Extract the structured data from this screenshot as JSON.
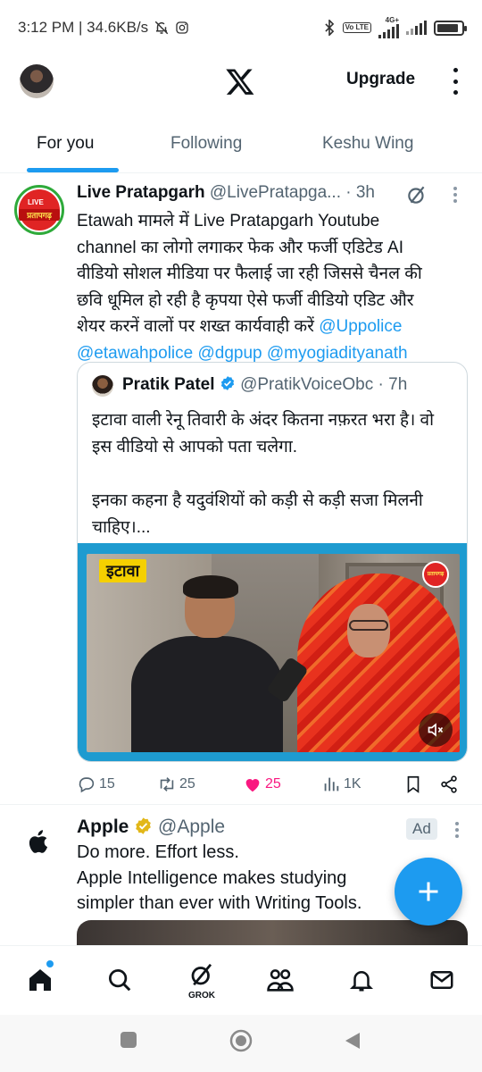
{
  "status_bar": {
    "time_speed": "3:12 PM | 34.6KB/s",
    "network_label": "4G+",
    "volte_label": "Vo LTE"
  },
  "header": {
    "upgrade_label": "Upgrade"
  },
  "tabs": [
    {
      "label": "For you",
      "active": true
    },
    {
      "label": "Following",
      "active": false
    },
    {
      "label": "Keshu Wing",
      "active": false
    }
  ],
  "tweet": {
    "author_name": "Live Pratapgarh",
    "handle_time": "@LivePratapga... · 3h",
    "avatar_live": "LIVE",
    "avatar_text": "प्रतापगढ़",
    "text_lines": [
      "Etawah मामले में Live Pratapgarh Youtube",
      "channel का लोगो लगाकर फेक और फर्जी एडिटेड AI",
      "वीडियो सोशल मीडिया पर फैलाई जा रही जिससे चैनल की",
      "छवि धूमिल हो रही है कृपया ऐसे फर्जी वीडियो एडिट और",
      "शेयर करनें वालों पर शख्त कार्यवाही करें "
    ],
    "mentions": [
      "@Uppolice",
      "@etawahpolice",
      "@dgpup",
      "@myogiadityanath"
    ],
    "quote": {
      "author_name": "Pratik Patel",
      "handle_time": "@PratikVoiceObc · 7h",
      "text_line1": "इटावा वाली रेनू तिवारी के अंदर कितना नफ़रत भरा है। वो",
      "text_line2": "इस वीडियो से आपको पता चलेगा.",
      "text_line3": "इनका कहना है यदुवंशियों को कड़ी से कड़ी सजा मिलनी",
      "text_line4": "चाहिए।...",
      "media_label": "इटावा",
      "media_logo": "प्रतापगढ़"
    },
    "actions": {
      "replies": "15",
      "reposts": "25",
      "likes": "25",
      "views": "1K"
    },
    "like_color": "#f91880"
  },
  "ad_tweet": {
    "author_name": "Apple",
    "handle": "@Apple",
    "ad_label": "Ad",
    "text_line1": "Do more. Effort less.",
    "text_line2": "Apple Intelligence makes studying",
    "text_line3": "simpler than ever with Writing Tools."
  },
  "bottom_nav": {
    "grok_label": "GROK",
    "items": [
      "home-icon",
      "search-icon",
      "grok-icon",
      "communities-icon",
      "notifications-icon",
      "messages-icon"
    ]
  },
  "colors": {
    "accent": "#1d9bf0",
    "secondary_text": "#536471"
  }
}
